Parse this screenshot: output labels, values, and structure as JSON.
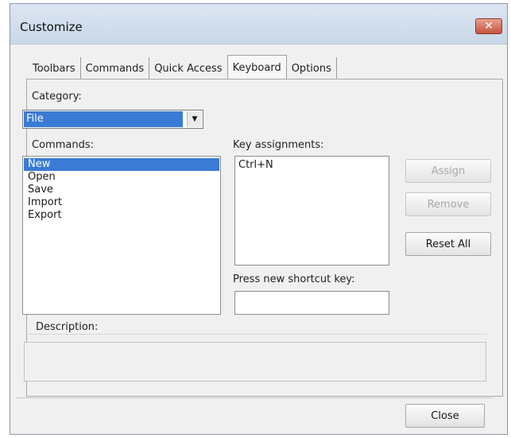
{
  "window": {
    "title": "Customize",
    "close_glyph": "✕"
  },
  "tabs": [
    {
      "label": "Toolbars",
      "active": false
    },
    {
      "label": "Commands",
      "active": false
    },
    {
      "label": "Quick Access",
      "active": false
    },
    {
      "label": "Keyboard",
      "active": true
    },
    {
      "label": "Options",
      "active": false
    }
  ],
  "keyboard": {
    "category_label": "Category:",
    "category_value": "File",
    "commands_label": "Commands:",
    "commands": [
      "New",
      "Open",
      "Save",
      "Import",
      "Export"
    ],
    "selected_command_index": 0,
    "key_assignments_label": "Key assignments:",
    "key_assignments": [
      "Ctrl+N"
    ],
    "press_new_shortcut_label": "Press new shortcut key:",
    "press_new_shortcut_value": "",
    "assign_label": "Assign",
    "remove_label": "Remove",
    "reset_all_label": "Reset All",
    "description_label": "Description:",
    "description_text": ""
  },
  "footer": {
    "close_label": "Close"
  },
  "colors": {
    "selection": "#3a7bd5",
    "title_bar": "#dce6f2",
    "close_button": "#c7533e"
  }
}
